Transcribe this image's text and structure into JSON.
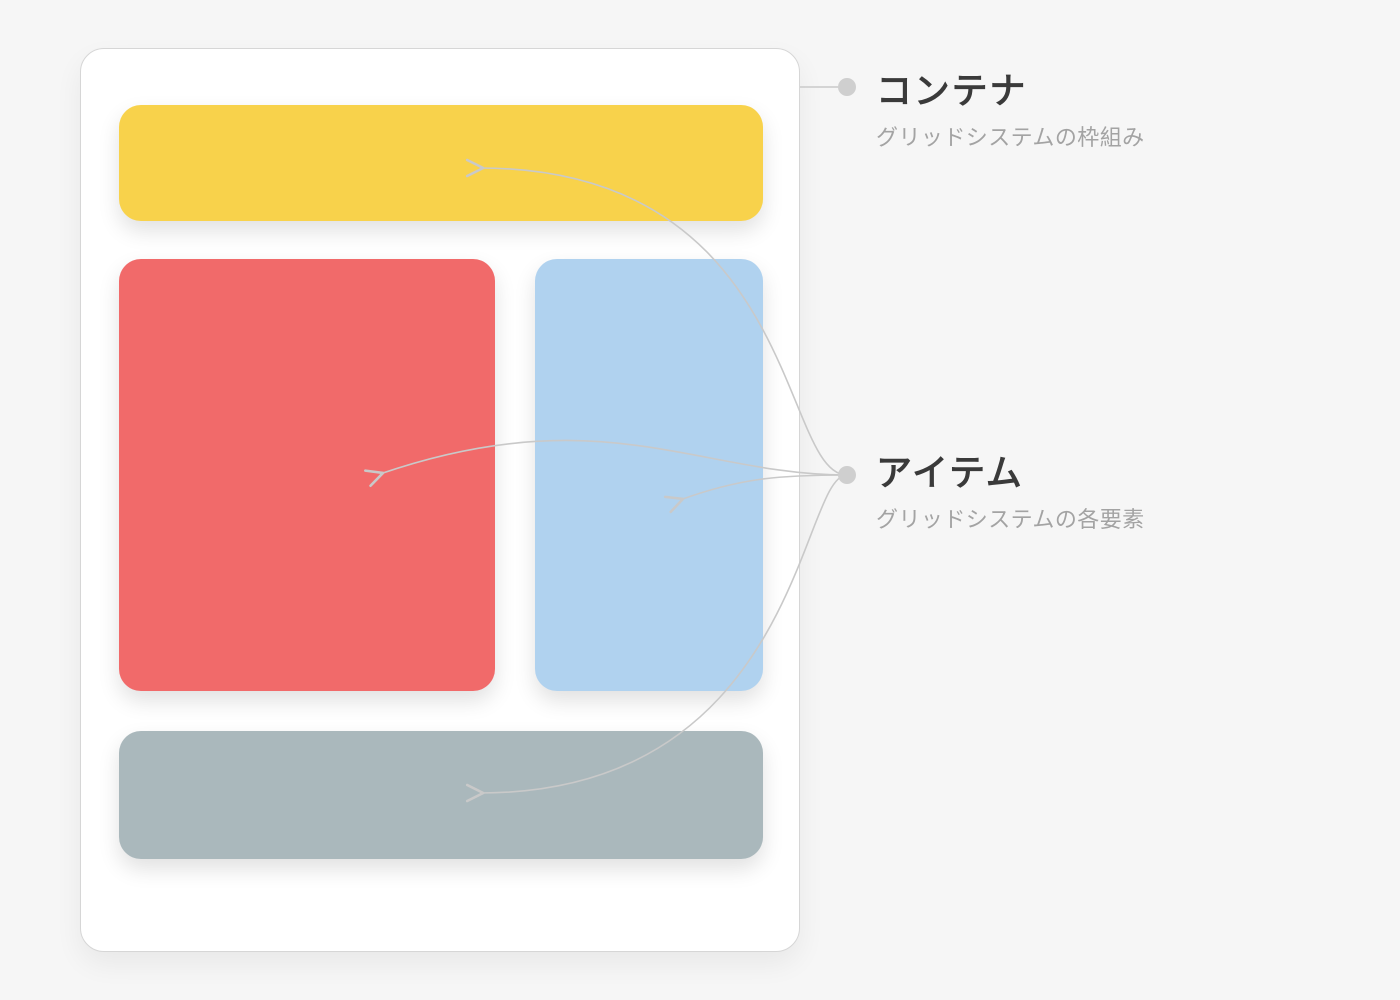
{
  "labels": {
    "container": {
      "title": "コンテナ",
      "subtitle": "グリッドシステムの枠組み"
    },
    "item": {
      "title": "アイテム",
      "subtitle": "グリッドシステムの各要素"
    }
  },
  "colors": {
    "yellow": "#f8d24b",
    "red": "#f16a6a",
    "blue": "#b0d2ef",
    "slate": "#aab8bc",
    "frame_border": "#d6d6d6",
    "dot": "#cfcfcf",
    "connector": "#c9c9c9",
    "text_primary": "#3a3a3a",
    "text_secondary": "#a3a3a3",
    "background": "#f6f6f6"
  }
}
